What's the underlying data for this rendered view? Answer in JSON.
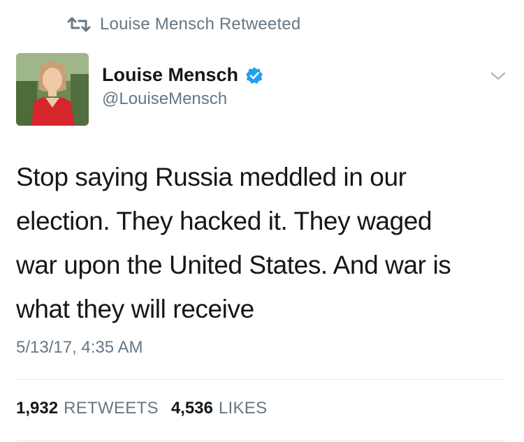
{
  "retweet_banner": {
    "icon": "retweet-icon",
    "label": "Louise Mensch Retweeted"
  },
  "author": {
    "avatar_icon": "avatar",
    "name": "Louise Mensch",
    "verified_icon": "verified-badge-icon",
    "handle": "@LouiseMensch",
    "menu_icon": "chevron-down-icon"
  },
  "tweet": {
    "text": "Stop saying Russia meddled in our\nelection. They hacked it. They waged\nwar upon the United States. And war is\nwhat they will receive",
    "timestamp": "5/13/17, 4:35 AM"
  },
  "stats": {
    "retweets_count": "1,932",
    "retweets_label": "RETWEETS",
    "likes_count": "4,536",
    "likes_label": "LIKES"
  },
  "colors": {
    "text_primary": "#14171a",
    "text_secondary": "#657786",
    "verified_blue": "#1da1f2",
    "divider": "#e1e8ed"
  }
}
